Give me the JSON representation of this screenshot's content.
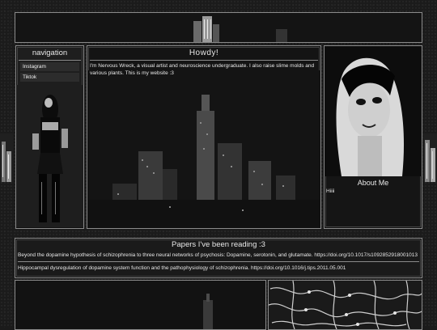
{
  "nav": {
    "title": "navigation",
    "items": [
      {
        "label": "Instagram"
      },
      {
        "label": "Tiktok"
      }
    ]
  },
  "main": {
    "title": "Howdy!",
    "intro": "I'm Nervous Wreck, a visual artist and neuroscience undergraduate. I also raise slime molds and various plants. This is my website :3"
  },
  "about": {
    "title": "About Me",
    "body": "Hiiii"
  },
  "papers": {
    "title": "Papers I've been reading :3",
    "items": [
      {
        "text": "Beyond the dopamine hypothesis of schizophrenia to three neural networks of psychosis: Dopamine, serotonin, and glutamate. https://doi.org/10.1017/s1092852918001013"
      },
      {
        "text": "Hippocampal dysregulation of dopamine system function and the pathophysiology of schizophrenia. https://doi.org/10.1016/j.tips.2011.05.001"
      }
    ]
  }
}
